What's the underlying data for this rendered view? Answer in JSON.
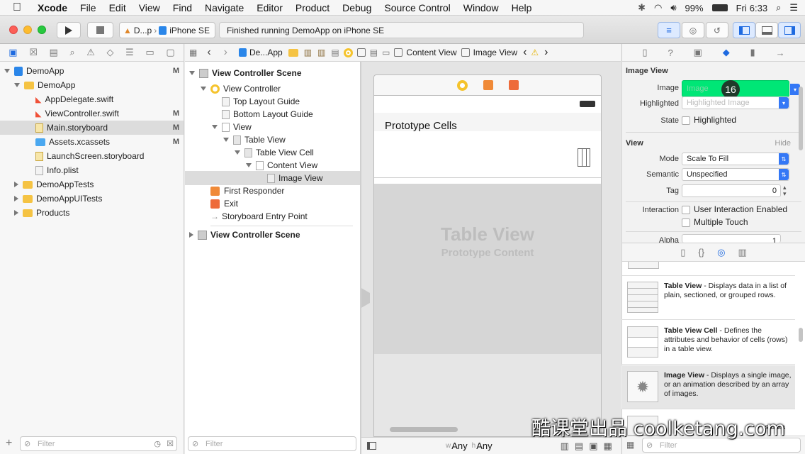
{
  "menubar": {
    "app": "Xcode",
    "items": [
      "File",
      "Edit",
      "View",
      "Find",
      "Navigate",
      "Editor",
      "Product",
      "Debug",
      "Source Control",
      "Window",
      "Help"
    ],
    "battery": "99%",
    "day": "Fri",
    "time": "6:33"
  },
  "toolbar": {
    "scheme": "D...p",
    "device": "iPhone SE",
    "status": "Finished running DemoApp on iPhone SE"
  },
  "navigator": {
    "items": [
      {
        "label": "DemoApp",
        "flag": "M"
      },
      {
        "label": "DemoApp",
        "flag": ""
      },
      {
        "label": "AppDelegate.swift",
        "flag": ""
      },
      {
        "label": "ViewController.swift",
        "flag": "M"
      },
      {
        "label": "Main.storyboard",
        "flag": "M"
      },
      {
        "label": "Assets.xcassets",
        "flag": "M"
      },
      {
        "label": "LaunchScreen.storyboard",
        "flag": ""
      },
      {
        "label": "Info.plist",
        "flag": ""
      },
      {
        "label": "DemoAppTests",
        "flag": ""
      },
      {
        "label": "DemoAppUITests",
        "flag": ""
      },
      {
        "label": "Products",
        "flag": ""
      }
    ],
    "filter_placeholder": "Filter"
  },
  "jumpbar": {
    "items": [
      "De...App",
      "Content View",
      "Image View"
    ]
  },
  "outline": {
    "items": [
      "View Controller Scene",
      "View Controller",
      "Top Layout Guide",
      "Bottom Layout Guide",
      "View",
      "Table View",
      "Table View Cell",
      "Content View",
      "Image View",
      "First Responder",
      "Exit",
      "Storyboard Entry Point",
      "View Controller Scene"
    ],
    "filter_placeholder": "Filter"
  },
  "canvas": {
    "prototype_cells": "Prototype Cells",
    "table_view": "Table View",
    "prototype_content": "Prototype Content",
    "size_w": "Any",
    "size_h": "Any",
    "w_prefix": "w",
    "h_prefix": "h"
  },
  "inspector": {
    "section_image_view": "Image View",
    "image_label": "Image",
    "image_placeholder": "Image",
    "image_badge": "16",
    "highlighted_label": "Highlighted",
    "highlighted_placeholder": "Highlighted Image",
    "state_label": "State",
    "state_value": "Highlighted",
    "section_view": "View",
    "hide_label": "Hide",
    "mode_label": "Mode",
    "mode_value": "Scale To Fill",
    "semantic_label": "Semantic",
    "semantic_value": "Unspecified",
    "tag_label": "Tag",
    "tag_value": "0",
    "interaction_label": "Interaction",
    "interaction_opt1": "User Interaction Enabled",
    "interaction_opt2": "Multiple Touch",
    "alpha_label": "Alpha",
    "alpha_value": "1"
  },
  "library": {
    "items": [
      {
        "title": "Table View",
        "desc": " - Displays data in a list of plain, sectioned, or grouped rows."
      },
      {
        "title": "Table View Cell",
        "desc": " - Defines the attributes and behavior of cells (rows) in a table view."
      },
      {
        "title": "Image View",
        "desc": " - Displays a single image, or an animation described by an array of images."
      },
      {
        "title": "",
        "desc": "s data"
      }
    ],
    "filter_placeholder": "Filter"
  },
  "watermark": "酷课堂出品 coolketang.com",
  "colors": {
    "accent": "#3478f6",
    "highlight_green": "#00e676",
    "badge_dark": "#1f3b2b"
  }
}
